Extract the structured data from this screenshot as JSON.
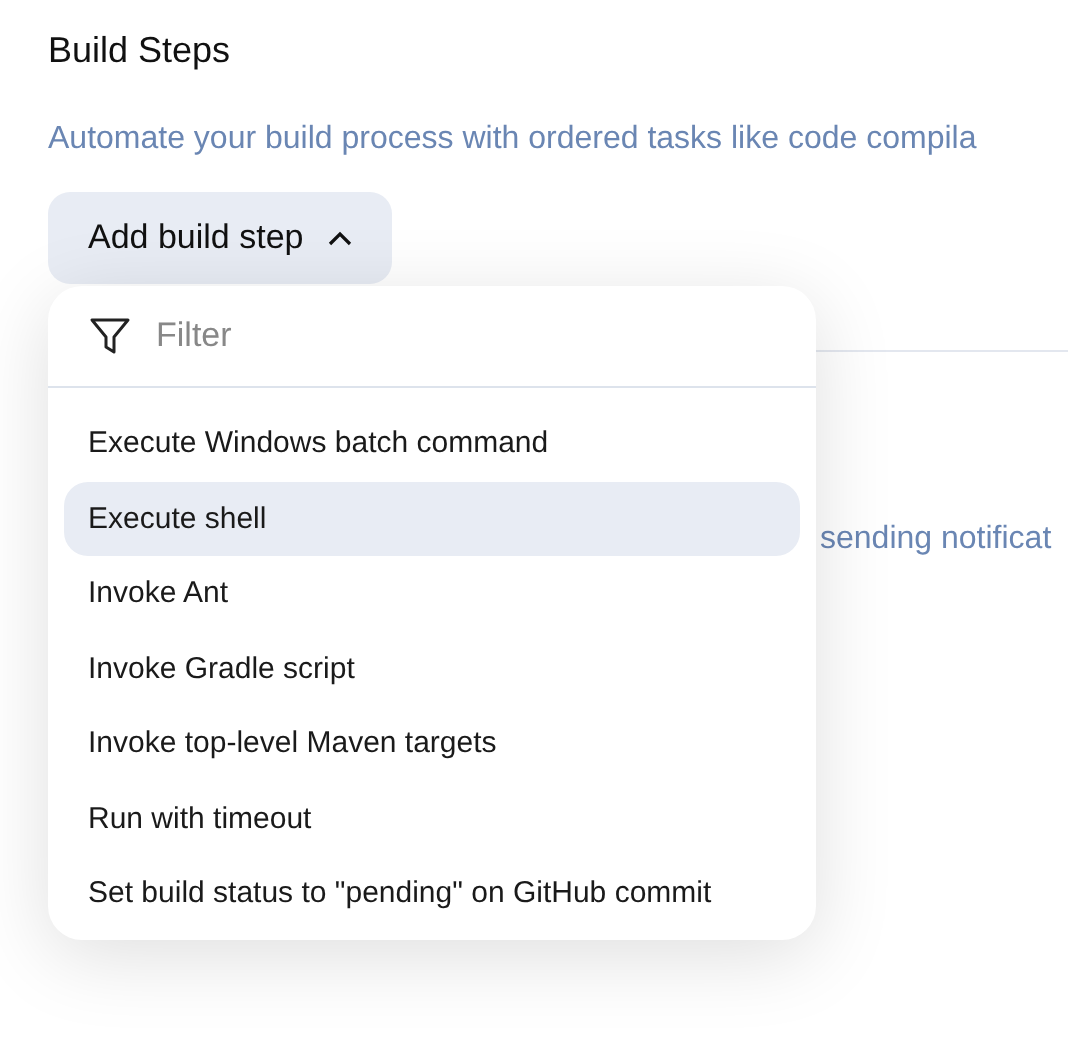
{
  "section": {
    "title": "Build Steps",
    "description": "Automate your build process with ordered tasks like code compila",
    "covered_text": "sending notificat"
  },
  "add_button": {
    "label": "Add build step",
    "expanded": true
  },
  "dropdown": {
    "filter": {
      "placeholder": "Filter"
    },
    "items": [
      {
        "label": "Execute Windows batch command",
        "selected": false
      },
      {
        "label": "Execute shell",
        "selected": true
      },
      {
        "label": "Invoke Ant",
        "selected": false
      },
      {
        "label": "Invoke Gradle script",
        "selected": false
      },
      {
        "label": "Invoke top-level Maven targets",
        "selected": false
      },
      {
        "label": "Run with timeout",
        "selected": false
      },
      {
        "label": "Set build status to \"pending\" on GitHub commit",
        "selected": false
      }
    ]
  }
}
